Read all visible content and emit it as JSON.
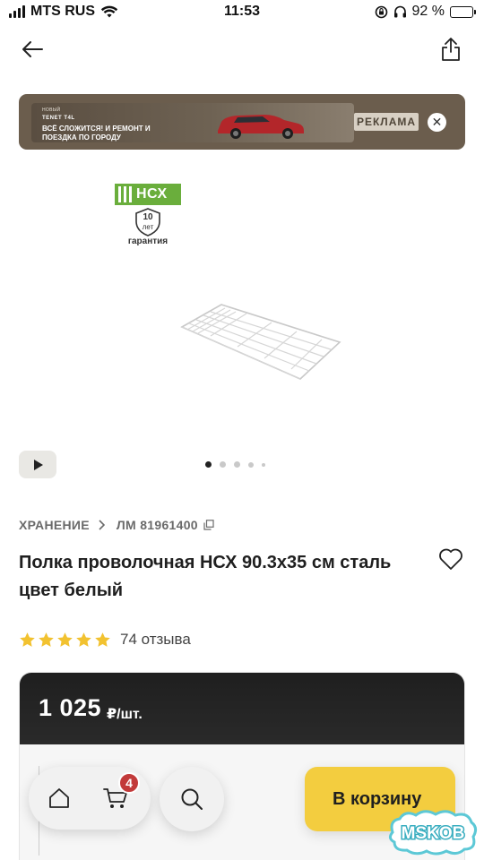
{
  "status_bar": {
    "carrier": "MTS RUS",
    "time": "11:53",
    "battery_percent": "92 %",
    "battery_level": 0.92
  },
  "header": {
    "back_icon": "arrow-left-icon",
    "share_icon": "share-icon"
  },
  "ad": {
    "small_text": "НОВЫЙ",
    "brand": "TENET T4L",
    "text": "ВСЁ СЛОЖИТСЯ! И РЕМОНТ И ПОЕЗДКА ПО ГОРОДУ",
    "label": "РЕКЛАМА",
    "close_symbol": "✕"
  },
  "product_media": {
    "brand_logo": "НСХ",
    "warranty_number": "10",
    "warranty_unit": "лет",
    "warranty_label": "гарантия",
    "dots_count": 5,
    "active_dot": 0
  },
  "breadcrumb": {
    "category": "ХРАНЕНИЕ",
    "sku": "ЛМ 81961400"
  },
  "product": {
    "title": "Полка проволочная НСХ 90.3x35 см сталь цвет белый",
    "rating": 5,
    "reviews": "74 отзыва"
  },
  "price": {
    "value": "1 025",
    "unit": "₽/шт."
  },
  "bottom_bar": {
    "cart_count": "4",
    "add_to_cart": "В корзину"
  },
  "watermark": "MSKOB",
  "colors": {
    "accent_yellow": "#f3cd3f",
    "badge_red": "#c23a3a",
    "brand_green": "#6aae3c",
    "ad_bg": "#6b5d4d",
    "star": "#f2c230"
  }
}
